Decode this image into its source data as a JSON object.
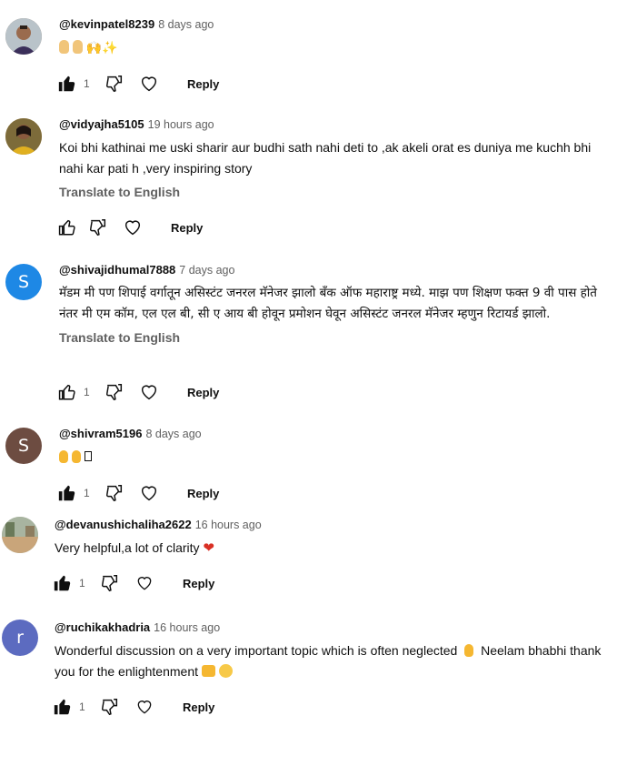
{
  "ui": {
    "reply_label": "Reply",
    "translate_label": "Translate to English"
  },
  "comments": [
    {
      "handle": "@kevinpatel8239",
      "time": "8 days ago",
      "text": "",
      "likes": "1",
      "liked": true,
      "avatar_letter": "",
      "avatar_color": "#8b6f5a"
    },
    {
      "handle": "@vidyajha5105",
      "time": "19 hours ago",
      "text": "Koi bhi kathinai me uski  sharir aur budhi sath nahi deti to ,ak akeli orat es duniya me kuchh bhi nahi kar pati h ,very inspiring story",
      "likes": "",
      "liked": false,
      "avatar_letter": "",
      "avatar_color": "#b88a3a"
    },
    {
      "handle": "@shivajidhumal7888",
      "time": "7 days ago",
      "text": "मॅडम मी पण शिपाई वर्गातून असिस्टंट जनरल मॅनेजर झालो बँक ऑफ महाराष्ट्र मध्ये. माझ पण शिक्षण फक्त 9 वी पास होते नंतर मी एम कॉम, एल एल बी, सी ए आय बी होवून प्रमोशन घेवून असिस्टंट जनरल मॅनेजर म्हणुन रिटायर्ड झालो.",
      "likes": "1",
      "liked": false,
      "avatar_letter": "S",
      "avatar_color": "#1e88e5"
    },
    {
      "handle": "@shivram5196",
      "time": "8 days ago",
      "text": "",
      "likes": "1",
      "liked": true,
      "avatar_letter": "S",
      "avatar_color": "#6d4c41"
    },
    {
      "handle": "@devanushichaliha2622",
      "time": "16 hours ago",
      "text": "Very helpful,a lot of clarity",
      "likes": "1",
      "liked": true,
      "avatar_letter": "",
      "avatar_color": "#9aa58a"
    },
    {
      "handle": "@ruchikakhadria",
      "time": "16 hours ago",
      "text": "Wonderful discussion on a very important topic which is often neglected",
      "text2": "Neelam bhabhi thank you for the enlightenment",
      "likes": "1",
      "liked": true,
      "avatar_letter": "r",
      "avatar_color": "#5c6bc0"
    }
  ]
}
